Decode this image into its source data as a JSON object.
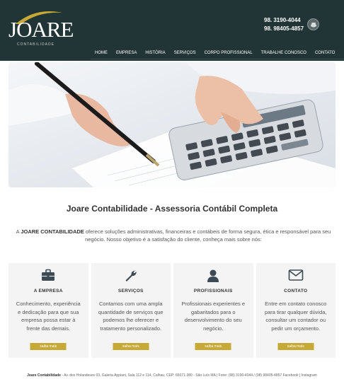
{
  "header": {
    "logo_word": "JOARE",
    "logo_sub": "CONTABILIDADE",
    "phone_1": "98.  3190-4044",
    "phone_2": "98. 98405-4857",
    "phone_icon": "phone-icon"
  },
  "nav": {
    "items": [
      {
        "label": "HOME"
      },
      {
        "label": "EMPRESA"
      },
      {
        "label": "HISTÓRIA"
      },
      {
        "label": "SERVIÇOS"
      },
      {
        "label": "CORPO PROFISSIONAL"
      },
      {
        "label": "TRABALHE CONOSCO"
      },
      {
        "label": "CONTATO"
      }
    ]
  },
  "main": {
    "title": "Joare Contabilidade - Assessoria Contábil Completa",
    "intro_prefix": "A ",
    "intro_brand": "JOARE CONTABILIDADE",
    "intro_text": " oferece soluções administrativas, financeiras e contábeis de forma segura, ética e responsável para seu negócio. Nosso objetivo é a satisfação do cliente, conheça mais sobre nós:"
  },
  "cards": [
    {
      "icon": "briefcase-icon",
      "title": "A EMPRESA",
      "text": "Conhecimento, experiência e dedicação para que sua empresa possa estar à frente das demais.",
      "button": "saiba mais"
    },
    {
      "icon": "wrench-icon",
      "title": "SERVIÇOS",
      "text": "Contamos com uma ampla quantidade de serviços que podemos lhe oferecer e tratamento personalizado.",
      "button": "saiba mais"
    },
    {
      "icon": "user-icon",
      "title": "PROFISSIONAIS",
      "text": "Profissionais experientes e gabaritados para o desenvolvimento do seu negócio.",
      "button": "saiba mais"
    },
    {
      "icon": "envelope-icon",
      "title": "CONTATO",
      "text": "Entre em contato conosco para tirar qualquer dúvida, consultar um contador ou pedir um orçamento.",
      "button": "saiba mais"
    }
  ],
  "footer": {
    "brand": "Joare Contabilidade",
    "text": " - Av. dos Holandeses 03, Galeria Appiani, Sala 112 e 114, Calhau, CEP: 65071-380 - São Luís MA | Fone: (98) 3190-4044 / (98) 98405-4857  Facebook | Instagram"
  },
  "colors": {
    "header_bg": "#223536",
    "accent": "#c7a935",
    "card_bg": "#f4f4f4"
  }
}
